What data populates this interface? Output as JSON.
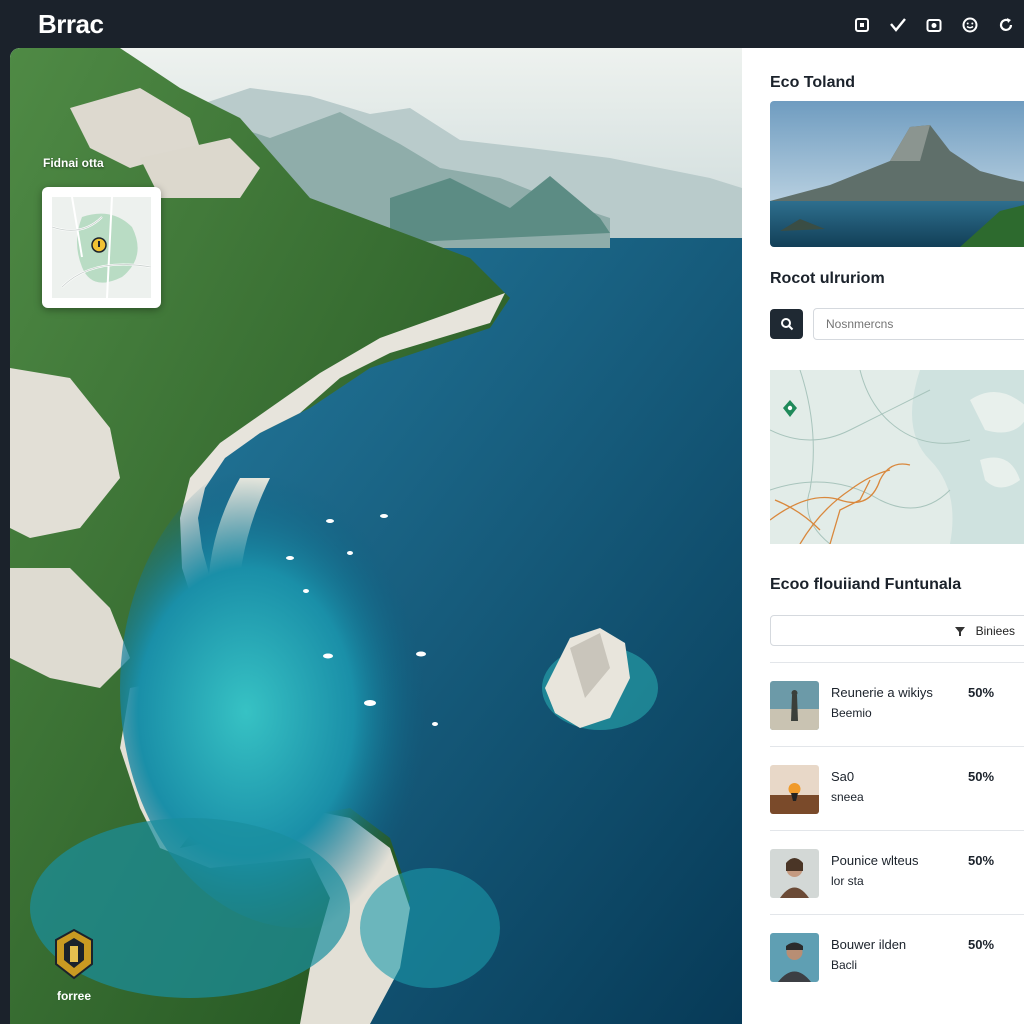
{
  "app": {
    "title": "Brrac"
  },
  "topbar": {
    "icons": [
      "square-icon",
      "check-icon",
      "camera-icon",
      "smile-icon",
      "refresh-icon"
    ]
  },
  "hero": {
    "mini_map_label": "Fidnai otta",
    "logo_text": "forree"
  },
  "panel": {
    "feature_title": "Eco Toland",
    "search_title": "Rocot ulruriom",
    "search_placeholder": "Nosnmercns",
    "list_title": "Ecoo flouiiand Funtunala",
    "filter_label": "Biniees",
    "items": [
      {
        "name": "Reunerie a wikiys",
        "sub": "Beemio",
        "pct": "50%"
      },
      {
        "name": "Sa0",
        "sub": "sneea",
        "pct": "50%"
      },
      {
        "name": "Pounice wlteus",
        "sub": "lor sta",
        "pct": "50%"
      },
      {
        "name": "Bouwer ilden",
        "sub": "Bacli",
        "pct": "50%"
      }
    ]
  },
  "colors": {
    "topbar": "#1b222b",
    "sea_deep": "#0b3f5c",
    "sea_shallow": "#2bb2b8",
    "forest": "#2f6b2a",
    "cliff": "#e8e6e0",
    "accent_green": "#1f8a5a",
    "route_orange": "#d9883d"
  }
}
